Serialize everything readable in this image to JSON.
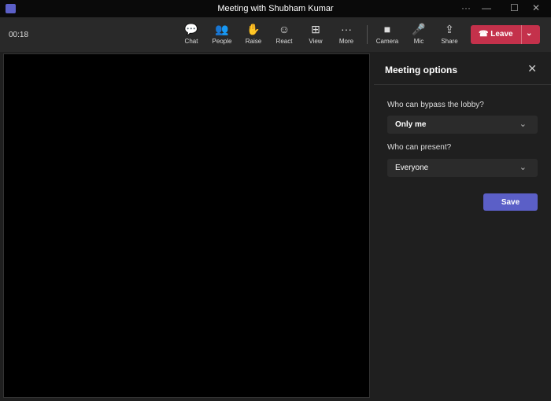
{
  "window": {
    "title": "Meeting with Shubham Kumar",
    "more": "···",
    "minimize": "—",
    "maximize": "☐",
    "close": "✕"
  },
  "toolbar": {
    "timer": "00:18",
    "buttons": [
      {
        "label": "Chat",
        "icon": "💬"
      },
      {
        "label": "People",
        "icon": "👥"
      },
      {
        "label": "Raise",
        "icon": "✋"
      },
      {
        "label": "React",
        "icon": "☺"
      },
      {
        "label": "View",
        "icon": "⊞"
      },
      {
        "label": "More",
        "icon": "···"
      },
      {
        "label": "Camera",
        "icon": "■"
      },
      {
        "label": "Mic",
        "icon": "🎤"
      },
      {
        "label": "Share",
        "icon": "⇪"
      }
    ],
    "leave": "Leave",
    "leave_icon": "☎",
    "leave_chevron": "⌄"
  },
  "panel": {
    "title": "Meeting options",
    "close": "✕",
    "lobby_label": "Who can bypass the lobby?",
    "lobby_value": "Only me",
    "present_label": "Who can present?",
    "present_value": "Everyone",
    "chevron": "⌄",
    "save": "Save"
  },
  "colors": {
    "accent": "#5b5fc7",
    "leave": "#c4314b"
  }
}
